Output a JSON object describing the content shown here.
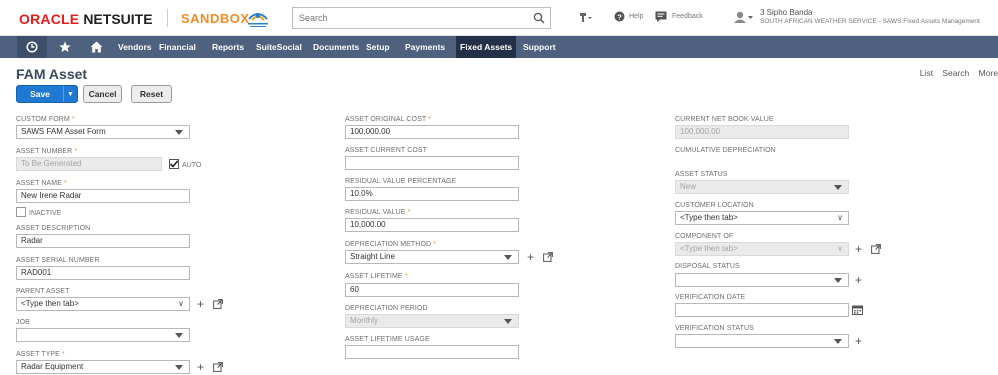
{
  "header": {
    "logo_oracle": "ORACLE",
    "logo_netsuite": "NETSUITE",
    "sandbox_label": "SANDBOX",
    "search_placeholder": "Search",
    "help_label": "Help",
    "feedback_label": "Feedback",
    "user_name": "3 Sipho Banda",
    "user_role": "SOUTH AFRICAN WEATHER SERVICE - SAWS Fixed Assets Management"
  },
  "nav": {
    "items": [
      "Vendors",
      "Financial",
      "Reports",
      "SuiteSocial",
      "Documents",
      "Setup",
      "Payments",
      "Fixed Assets",
      "Support"
    ],
    "active": "Fixed Assets"
  },
  "page": {
    "title": "FAM Asset",
    "links": [
      "List",
      "Search",
      "More"
    ]
  },
  "buttons": {
    "save": "Save",
    "cancel": "Cancel",
    "reset": "Reset"
  },
  "form": {
    "custom_form": {
      "label": "CUSTOM FORM",
      "value": "SAWS FAM Asset Form"
    },
    "asset_number": {
      "label": "ASSET NUMBER",
      "value": "To Be Generated",
      "auto_label": "AUTO"
    },
    "asset_name": {
      "label": "ASSET NAME",
      "value": "New Irene Radar"
    },
    "inactive": {
      "label": "INACTIVE"
    },
    "asset_description": {
      "label": "ASSET DESCRIPTION",
      "value": "Radar"
    },
    "asset_serial_number": {
      "label": "ASSET SERIAL NUMBER",
      "value": "RAD001"
    },
    "parent_asset": {
      "label": "PARENT ASSET",
      "value": "<Type then tab>"
    },
    "job": {
      "label": "JOB",
      "value": ""
    },
    "asset_type": {
      "label": "ASSET TYPE",
      "value": "Radar Equipment"
    },
    "asset_original_cost": {
      "label": "ASSET ORIGINAL COST",
      "value": "100,000.00"
    },
    "asset_current_cost": {
      "label": "ASSET CURRENT COST",
      "value": ""
    },
    "residual_value_percentage": {
      "label": "RESIDUAL VALUE PERCENTAGE",
      "value": "10.0%"
    },
    "residual_value": {
      "label": "RESIDUAL VALUE",
      "value": "10,000.00"
    },
    "depreciation_method": {
      "label": "DEPRECIATION METHOD",
      "value": "Straight Line"
    },
    "asset_lifetime": {
      "label": "ASSET LIFETIME",
      "value": "60"
    },
    "depreciation_period": {
      "label": "DEPRECIATION PERIOD",
      "value": "Monthly"
    },
    "asset_lifetime_usage": {
      "label": "ASSET LIFETIME USAGE",
      "value": ""
    },
    "current_net_book_value": {
      "label": "CURRENT NET BOOK VALUE",
      "value": "100,000.00"
    },
    "cumulative_depreciation": {
      "label": "CUMULATIVE DEPRECIATION"
    },
    "asset_status": {
      "label": "ASSET STATUS",
      "value": "New"
    },
    "customer_location": {
      "label": "CUSTOMER LOCATION",
      "value": "<Type then tab>"
    },
    "component_of": {
      "label": "COMPONENT OF",
      "value": "<Type then tab>"
    },
    "disposal_status": {
      "label": "DISPOSAL STATUS",
      "value": ""
    },
    "verification_date": {
      "label": "VERIFICATION DATE",
      "value": ""
    },
    "verification_status": {
      "label": "VERIFICATION STATUS",
      "value": ""
    }
  },
  "colors": {
    "nav_bg": "#4e617f",
    "nav_active": "#243047",
    "save_button": "#1f78d1",
    "required_star": "#f28c28",
    "oracle_red": "#e11d1d"
  }
}
